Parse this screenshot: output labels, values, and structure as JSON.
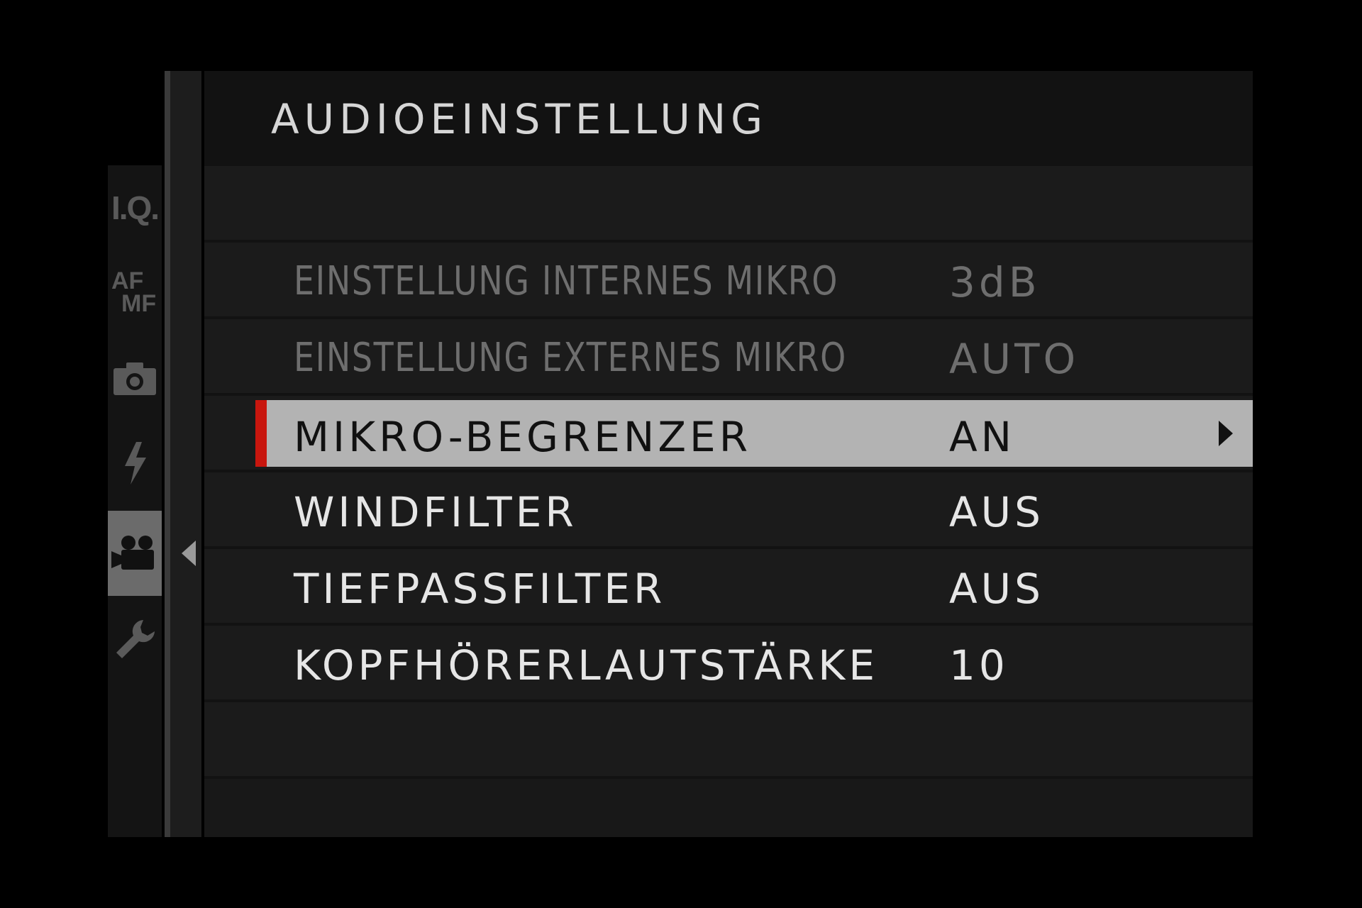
{
  "menu": {
    "title": "AUDIOEINSTELLUNG",
    "items": [
      {
        "label": "EINSTELLUNG INTERNES MIKRO",
        "value": "3dB",
        "state": "disabled"
      },
      {
        "label": "EINSTELLUNG EXTERNES MIKRO",
        "value": "AUTO",
        "state": "disabled"
      },
      {
        "label": "MIKRO-BEGRENZER",
        "value": "AN",
        "state": "selected"
      },
      {
        "label": "WINDFILTER",
        "value": "AUS",
        "state": "normal"
      },
      {
        "label": "TIEFPASSFILTER",
        "value": "AUS",
        "state": "normal"
      },
      {
        "label": "KOPFHÖRERLAUTSTÄRKE",
        "value": "10",
        "state": "normal"
      }
    ]
  },
  "tabs": {
    "iq": {
      "label": "I.Q.",
      "icon": "image-quality-icon"
    },
    "af": {
      "label_top": "AF",
      "label_bottom": "MF",
      "icon": "af-mf-icon"
    },
    "camera": {
      "icon": "camera-icon"
    },
    "flash": {
      "icon": "flash-icon"
    },
    "movie": {
      "icon": "movie-camera-icon",
      "active": true
    },
    "setup": {
      "icon": "wrench-icon"
    }
  },
  "colors": {
    "selection_marker": "#c8160e",
    "selected_row": "#b3b3b3",
    "active_tab": "#6b6b6b",
    "text": "#e6e6e6",
    "disabled_text": "#6e6e6e"
  }
}
